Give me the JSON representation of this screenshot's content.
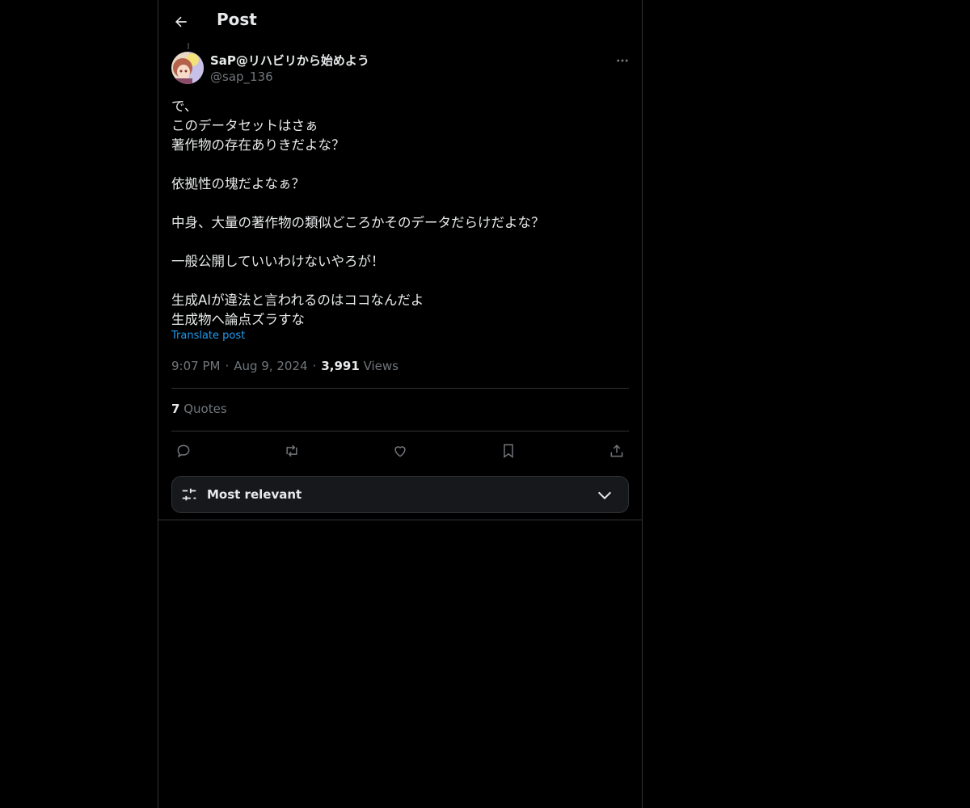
{
  "header": {
    "title": "Post"
  },
  "post": {
    "author_name": "SaP@リハビリから始めよう",
    "author_handle": "@sap_136",
    "lines": [
      "で、",
      "このデータセットはさぁ",
      "著作物の存在ありきだよな？",
      "",
      "依拠性の塊だよなぁ？",
      "",
      "中身、大量の著作物の類似どころかそのデータだらけだよな？",
      "",
      "一般公開していいわけないやろが！",
      "",
      "生成AIが違法と言われるのはココなんだよ",
      "生成物へ論点ズラすな"
    ],
    "translate_label": "Translate post",
    "time": "9:07 PM",
    "date": "Aug 9, 2024",
    "views_count": "3,991",
    "views_label": "Views",
    "separator": "·"
  },
  "stats": {
    "quotes_count": "7",
    "quotes_label": "Quotes"
  },
  "actions": {
    "icons": [
      "reply-icon",
      "retweet-icon",
      "like-icon",
      "bookmark-icon",
      "share-icon"
    ]
  },
  "sort": {
    "label": "Most relevant"
  },
  "colors": {
    "background": "#000000",
    "text": "#e7e9ea",
    "muted": "#71767b",
    "accent": "#1d9bf0",
    "border": "#2f3336"
  }
}
